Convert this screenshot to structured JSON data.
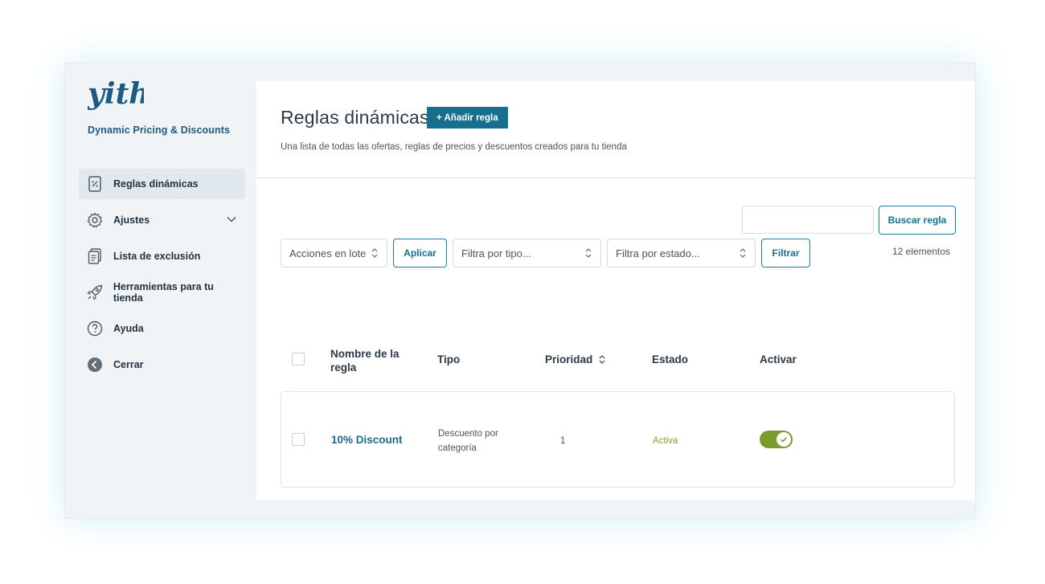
{
  "brand": {
    "logo_text": "yith",
    "plugin_name": "Dynamic Pricing & Discounts"
  },
  "sidebar": {
    "items": [
      {
        "label": "Reglas dinámicas",
        "icon": "discount-tag-icon",
        "active": true
      },
      {
        "label": "Ajustes",
        "icon": "gear-icon",
        "has_chevron": true
      },
      {
        "label": "Lista de exclusión",
        "icon": "clipboard-list-icon"
      },
      {
        "label": "Herramientas para tu tienda",
        "icon": "rocket-icon"
      },
      {
        "label": "Ayuda",
        "icon": "question-circle-icon"
      },
      {
        "label": "Cerrar",
        "icon": "back-arrow-circle-icon"
      }
    ]
  },
  "header": {
    "title": "Reglas dinámicas",
    "add_button": "+ Añadir regla",
    "subtitle": "Una lista de todas las ofertas, reglas de precios y descuentos creados para tu tienda"
  },
  "search": {
    "value": "",
    "button": "Buscar regla"
  },
  "count_label": "12 elementos",
  "filters": {
    "bulk_actions": "Acciones en lote",
    "apply_button": "Aplicar",
    "type_filter": "Filtra por tipo...",
    "status_filter": "Filtra por estado...",
    "filter_button": "Filtrar"
  },
  "table": {
    "columns": {
      "name": "Nombre de la regla",
      "type": "Tipo",
      "priority": "Prioridad",
      "status": "Estado",
      "activate": "Activar"
    },
    "rows": [
      {
        "name": "10% Discount",
        "type": "Descuento por categoría",
        "priority": "1",
        "status": "Activa",
        "enabled": true
      }
    ]
  },
  "colors": {
    "accent": "#166f8e",
    "toggle_on": "#7a9a2a",
    "status_active": "#8d9a2e"
  }
}
